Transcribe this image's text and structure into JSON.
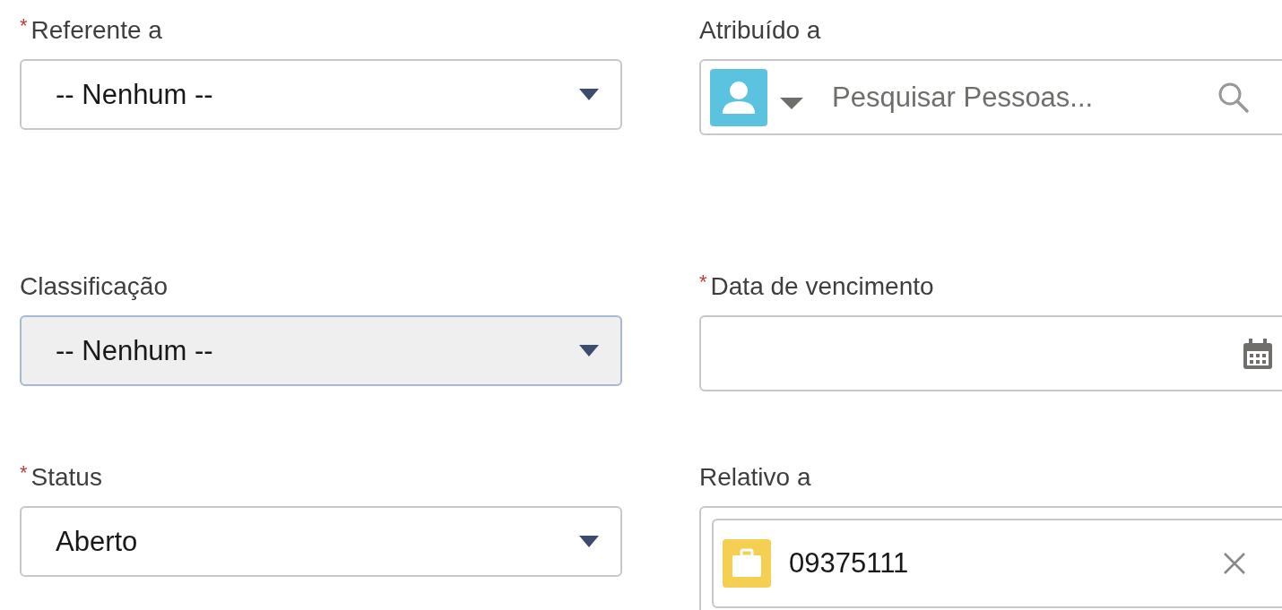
{
  "rows": [
    {
      "fields": [
        {
          "kind": "select",
          "label": "Referente a",
          "required_mark": "*",
          "value": "-- Nenhum --",
          "disabled": false
        },
        {
          "kind": "lookup",
          "label": "Atribuído a",
          "placeholder": "Pesquisar Pessoas..."
        }
      ]
    },
    {
      "fields": [
        {
          "kind": "select",
          "label": "Classificação",
          "value": "-- Nenhum --",
          "disabled": true
        },
        {
          "kind": "date",
          "label": "Data de vencimento",
          "required_mark": "*"
        }
      ]
    },
    {
      "fields": [
        {
          "kind": "select",
          "label": "Status",
          "required_mark": "*",
          "value": "Aberto",
          "disabled": false
        },
        {
          "kind": "pill",
          "label": "Relativo a",
          "value": "09375111"
        }
      ]
    }
  ]
}
